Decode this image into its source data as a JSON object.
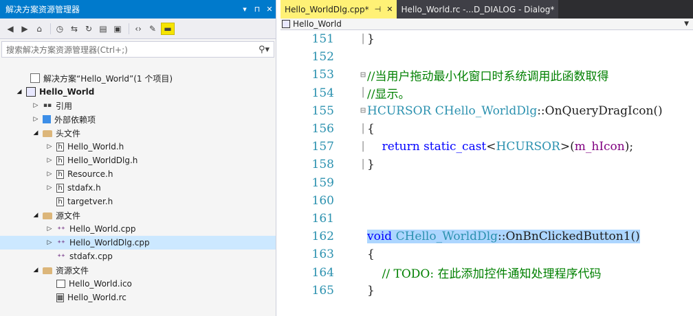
{
  "solution_explorer": {
    "title": "解决方案资源管理器",
    "title_controls": [
      "▾",
      "⊓",
      "✕"
    ],
    "search_placeholder": "搜索解决方案资源管理器(Ctrl+;)",
    "tree": [
      {
        "label": "解决方案“Hello_World”(1 个项目)",
        "depth": 0,
        "arrow": "",
        "icon": "solution-icon",
        "bold": false
      },
      {
        "label": "Hello_World",
        "depth": 0,
        "arrow": "◢",
        "icon": "project-icon",
        "bold": true
      },
      {
        "label": "引用",
        "depth": 1,
        "arrow": "▷",
        "icon": "references-icon",
        "bold": false
      },
      {
        "label": "外部依赖项",
        "depth": 1,
        "arrow": "▷",
        "icon": "external-dependencies-icon",
        "bold": false
      },
      {
        "label": "头文件",
        "depth": 1,
        "arrow": "◢",
        "icon": "folder-icon",
        "bold": false
      },
      {
        "label": "Hello_World.h",
        "depth": 2,
        "arrow": "▷",
        "icon": "header-file-icon",
        "bold": false
      },
      {
        "label": "Hello_WorldDlg.h",
        "depth": 2,
        "arrow": "▷",
        "icon": "header-file-icon",
        "bold": false
      },
      {
        "label": "Resource.h",
        "depth": 2,
        "arrow": "▷",
        "icon": "header-file-icon",
        "bold": false
      },
      {
        "label": "stdafx.h",
        "depth": 2,
        "arrow": "▷",
        "icon": "header-file-icon",
        "bold": false
      },
      {
        "label": "targetver.h",
        "depth": 2,
        "arrow": "",
        "icon": "header-file-icon",
        "bold": false
      },
      {
        "label": "源文件",
        "depth": 1,
        "arrow": "◢",
        "icon": "folder-icon",
        "bold": false
      },
      {
        "label": "Hello_World.cpp",
        "depth": 2,
        "arrow": "▷",
        "icon": "cpp-file-icon",
        "bold": false
      },
      {
        "label": "Hello_WorldDlg.cpp",
        "depth": 2,
        "arrow": "▷",
        "icon": "cpp-file-icon",
        "bold": false,
        "selected": true
      },
      {
        "label": "stdafx.cpp",
        "depth": 2,
        "arrow": "",
        "icon": "cpp-file-icon",
        "bold": false
      },
      {
        "label": "资源文件",
        "depth": 1,
        "arrow": "◢",
        "icon": "folder-icon",
        "bold": false
      },
      {
        "label": "Hello_World.ico",
        "depth": 2,
        "arrow": "",
        "icon": "image-file-icon",
        "bold": false
      },
      {
        "label": "Hello_World.rc",
        "depth": 2,
        "arrow": "",
        "icon": "resource-file-icon",
        "bold": false
      }
    ]
  },
  "editor": {
    "tabs": [
      {
        "label": "Hello_WorldDlg.cpp*",
        "pin": "⊣",
        "close": "✕",
        "active": true
      },
      {
        "label": "Hello_World.rc -...D_DIALOG - Dialog*",
        "active": false
      }
    ],
    "nav_project": "Hello_World",
    "lines": [
      {
        "num": "151",
        "fold": "│",
        "segs": [
          {
            "t": "}",
            "c": "pl"
          }
        ],
        "indent": 0
      },
      {
        "num": "152",
        "fold": "",
        "segs": [],
        "indent": 0
      },
      {
        "num": "153",
        "fold": "⊟",
        "segs": [
          {
            "t": "//当用户拖动最小化窗口时系统调用此函数取得",
            "c": "cm"
          }
        ],
        "indent": 0
      },
      {
        "num": "154",
        "fold": "│",
        "segs": [
          {
            "t": "//显示。",
            "c": "cm"
          }
        ],
        "indent": 0
      },
      {
        "num": "155",
        "fold": "⊟",
        "segs": [
          {
            "t": "HCURSOR ",
            "c": "ty"
          },
          {
            "t": "CHello_WorldDlg",
            "c": "ty"
          },
          {
            "t": "::OnQueryDragIcon()",
            "c": "pl"
          }
        ],
        "indent": 0
      },
      {
        "num": "156",
        "fold": "│",
        "segs": [
          {
            "t": "{",
            "c": "pl"
          }
        ],
        "indent": 0
      },
      {
        "num": "157",
        "fold": "│",
        "segs": [
          {
            "t": "    return ",
            "c": "kw"
          },
          {
            "t": "static_cast",
            "c": "kw"
          },
          {
            "t": "<",
            "c": "pl"
          },
          {
            "t": "HCURSOR",
            "c": "ty"
          },
          {
            "t": ">(",
            "c": "pl"
          },
          {
            "t": "m_hIcon",
            "c": "mem"
          },
          {
            "t": ");",
            "c": "pl"
          }
        ],
        "indent": 0
      },
      {
        "num": "158",
        "fold": "│",
        "segs": [
          {
            "t": "}",
            "c": "pl"
          }
        ],
        "indent": 0
      },
      {
        "num": "159",
        "fold": "",
        "segs": [],
        "indent": 0
      },
      {
        "num": "160",
        "fold": "",
        "segs": [],
        "indent": 0,
        "mod": true
      },
      {
        "num": "161",
        "fold": "",
        "segs": [],
        "indent": 0,
        "mod": true
      },
      {
        "num": "162",
        "fold": "",
        "segs": [
          {
            "t": "void ",
            "c": "kw"
          },
          {
            "t": "CHello_WorldDlg",
            "c": "ty"
          },
          {
            "t": "::OnBnClickedButton1()",
            "c": "pl"
          }
        ],
        "indent": 0,
        "mod": true,
        "highlight": true
      },
      {
        "num": "163",
        "fold": "",
        "segs": [
          {
            "t": "{",
            "c": "pl"
          }
        ],
        "indent": 0,
        "mod": true
      },
      {
        "num": "164",
        "fold": "",
        "segs": [
          {
            "t": "    // TODO: 在此添加控件通知处理程序代码",
            "c": "cm"
          }
        ],
        "indent": 0,
        "mod": true
      },
      {
        "num": "165",
        "fold": "",
        "segs": [
          {
            "t": "}",
            "c": "pl"
          }
        ],
        "indent": 0,
        "mod": true
      }
    ]
  }
}
